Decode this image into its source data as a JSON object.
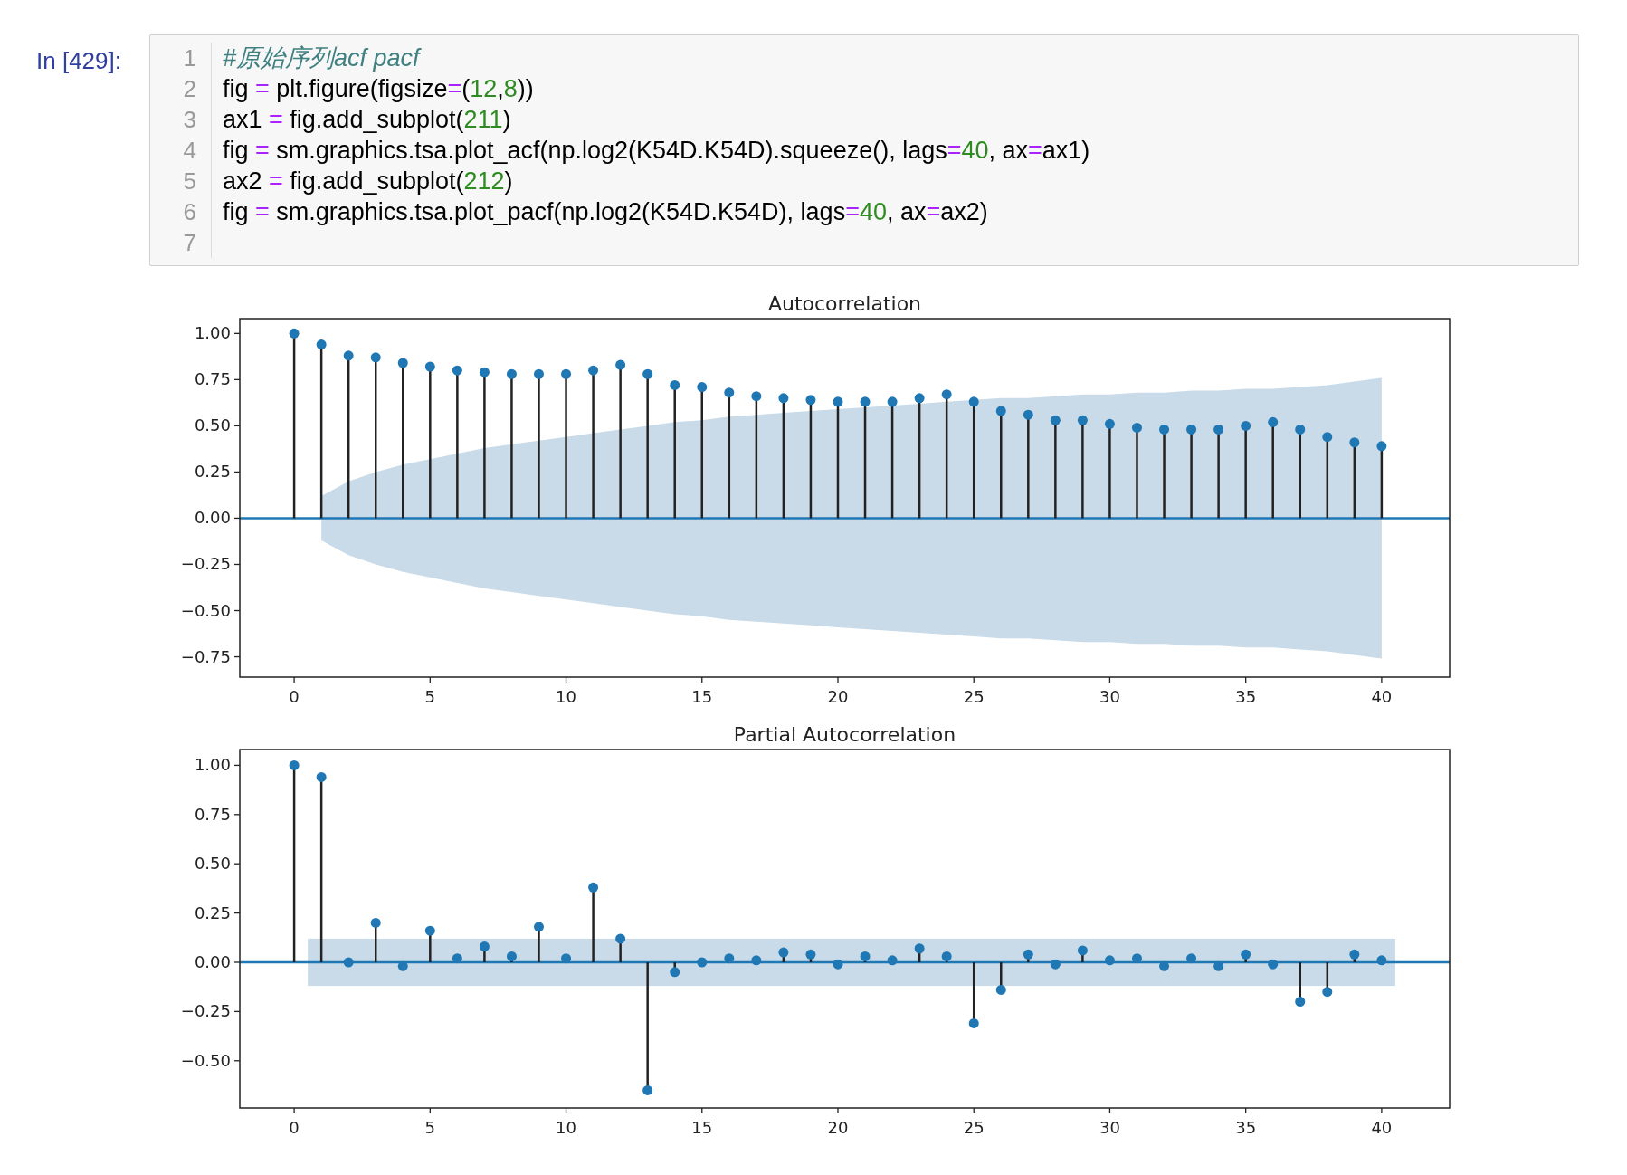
{
  "cell": {
    "prompt": "In [429]:",
    "lines": [
      {
        "number": "1",
        "tokens": [
          {
            "kind": "comment",
            "text": "#原始序列acf pacf"
          }
        ]
      },
      {
        "number": "2",
        "tokens": [
          {
            "kind": "text",
            "text": "fig "
          },
          {
            "kind": "op",
            "text": "="
          },
          {
            "kind": "text",
            "text": " plt.figure(figsize"
          },
          {
            "kind": "op",
            "text": "="
          },
          {
            "kind": "text",
            "text": "("
          },
          {
            "kind": "num",
            "text": "12"
          },
          {
            "kind": "text",
            "text": ","
          },
          {
            "kind": "num",
            "text": "8"
          },
          {
            "kind": "text",
            "text": "))"
          }
        ]
      },
      {
        "number": "3",
        "tokens": [
          {
            "kind": "text",
            "text": "ax1 "
          },
          {
            "kind": "op",
            "text": "="
          },
          {
            "kind": "text",
            "text": " fig.add_subplot("
          },
          {
            "kind": "num",
            "text": "211"
          },
          {
            "kind": "text",
            "text": ")"
          }
        ]
      },
      {
        "number": "4",
        "tokens": [
          {
            "kind": "text",
            "text": "fig "
          },
          {
            "kind": "op",
            "text": "="
          },
          {
            "kind": "text",
            "text": " sm.graphics.tsa.plot_acf(np.log2(K54D.K54D).squeeze(), lags"
          },
          {
            "kind": "op",
            "text": "="
          },
          {
            "kind": "num",
            "text": "40"
          },
          {
            "kind": "text",
            "text": ", ax"
          },
          {
            "kind": "op",
            "text": "="
          },
          {
            "kind": "text",
            "text": "ax1)"
          }
        ]
      },
      {
        "number": "5",
        "tokens": [
          {
            "kind": "text",
            "text": "ax2 "
          },
          {
            "kind": "op",
            "text": "="
          },
          {
            "kind": "text",
            "text": " fig.add_subplot("
          },
          {
            "kind": "num",
            "text": "212"
          },
          {
            "kind": "text",
            "text": ")"
          }
        ]
      },
      {
        "number": "6",
        "tokens": [
          {
            "kind": "text",
            "text": "fig "
          },
          {
            "kind": "op",
            "text": "="
          },
          {
            "kind": "text",
            "text": " sm.graphics.tsa.plot_pacf(np.log2(K54D.K54D), lags"
          },
          {
            "kind": "op",
            "text": "="
          },
          {
            "kind": "num",
            "text": "40"
          },
          {
            "kind": "text",
            "text": ", ax"
          },
          {
            "kind": "op",
            "text": "="
          },
          {
            "kind": "text",
            "text": "ax2)"
          }
        ]
      },
      {
        "number": "7"
      }
    ]
  },
  "charts": [
    {
      "chart_data": {
        "type": "scatter",
        "title": "Autocorrelation",
        "xlim": [
          -2,
          42.5
        ],
        "ylim": [
          -0.86,
          1.08
        ],
        "x": [
          0,
          1,
          2,
          3,
          4,
          5,
          6,
          7,
          8,
          9,
          10,
          11,
          12,
          13,
          14,
          15,
          16,
          17,
          18,
          19,
          20,
          21,
          22,
          23,
          24,
          25,
          26,
          27,
          28,
          29,
          30,
          31,
          32,
          33,
          34,
          35,
          36,
          37,
          38,
          39,
          40
        ],
        "series": [
          {
            "color": "#1f77b4",
            "values": [
              1.0,
              0.94,
              0.88,
              0.87,
              0.84,
              0.82,
              0.8,
              0.79,
              0.78,
              0.78,
              0.78,
              0.8,
              0.83,
              0.78,
              0.72,
              0.71,
              0.68,
              0.66,
              0.65,
              0.64,
              0.63,
              0.63,
              0.63,
              0.65,
              0.67,
              0.63,
              0.58,
              0.56,
              0.53,
              0.53,
              0.51,
              0.49,
              0.48,
              0.48,
              0.48,
              0.5,
              0.52,
              0.48,
              0.44,
              0.41,
              0.39
            ]
          },
          {
            "type": "area",
            "color": "#c9dbe9",
            "values": [
              null,
              0.12,
              0.2,
              0.25,
              0.29,
              0.32,
              0.35,
              0.38,
              0.4,
              0.42,
              0.44,
              0.46,
              0.48,
              0.5,
              0.52,
              0.53,
              0.55,
              0.56,
              0.57,
              0.58,
              0.59,
              0.6,
              0.61,
              0.62,
              0.63,
              0.64,
              0.65,
              0.65,
              0.66,
              0.67,
              0.67,
              0.68,
              0.68,
              0.69,
              0.69,
              0.7,
              0.7,
              0.71,
              0.72,
              0.74,
              0.76
            ]
          },
          {
            "type": "area",
            "color": "#c9dbe9",
            "values": [
              null,
              -0.12,
              -0.2,
              -0.25,
              -0.29,
              -0.32,
              -0.35,
              -0.38,
              -0.4,
              -0.42,
              -0.44,
              -0.46,
              -0.48,
              -0.5,
              -0.52,
              -0.53,
              -0.55,
              -0.56,
              -0.57,
              -0.58,
              -0.59,
              -0.6,
              -0.61,
              -0.62,
              -0.63,
              -0.64,
              -0.65,
              -0.65,
              -0.66,
              -0.67,
              -0.67,
              -0.68,
              -0.68,
              -0.69,
              -0.69,
              -0.7,
              -0.7,
              -0.71,
              -0.72,
              -0.74,
              -0.76
            ]
          }
        ],
        "xticks": [
          0,
          5,
          10,
          15,
          20,
          25,
          30,
          35,
          40
        ],
        "ref_lines": [
          {
            "axis": "y",
            "value": 0,
            "color": "#1f77b4"
          }
        ],
        "yticks": [
          {
            "value": 1,
            "label": "1.00"
          },
          {
            "value": 0.75,
            "label": "0.75"
          },
          {
            "value": 0.5,
            "label": "0.50"
          },
          {
            "value": 0.25,
            "label": "0.25"
          },
          {
            "value": 0,
            "label": "0.00"
          },
          {
            "value": -0.25,
            "label": "−0.25"
          },
          {
            "value": -0.5,
            "label": "−0.50"
          },
          {
            "value": -0.75,
            "label": "−0.75"
          }
        ]
      }
    },
    {
      "chart_data": {
        "type": "scatter",
        "title": "Partial Autocorrelation",
        "xlim": [
          -2,
          42.5
        ],
        "ylim": [
          -0.74,
          1.08
        ],
        "x": [
          0,
          1,
          2,
          3,
          4,
          5,
          6,
          7,
          8,
          9,
          10,
          11,
          12,
          13,
          14,
          15,
          16,
          17,
          18,
          19,
          20,
          21,
          22,
          23,
          24,
          25,
          26,
          27,
          28,
          29,
          30,
          31,
          32,
          33,
          34,
          35,
          36,
          37,
          38,
          39,
          40
        ],
        "series": [
          {
            "color": "#1f77b4",
            "values": [
              1.0,
              0.94,
              0.0,
              0.2,
              -0.02,
              0.16,
              0.02,
              0.08,
              0.03,
              0.18,
              0.02,
              0.38,
              0.12,
              -0.65,
              -0.05,
              0.0,
              0.02,
              0.01,
              0.05,
              0.04,
              -0.01,
              0.03,
              0.01,
              0.07,
              0.03,
              -0.31,
              -0.14,
              0.04,
              -0.01,
              0.06,
              0.01,
              0.02,
              -0.02,
              0.02,
              -0.02,
              0.04,
              -0.01,
              -0.2,
              -0.15,
              0.04,
              0.01
            ]
          }
        ],
        "xticks": [
          0,
          5,
          10,
          15,
          20,
          25,
          30,
          35,
          40
        ],
        "ref_lines": [
          {
            "axis": "y",
            "value": 0,
            "color": "#1f77b4"
          }
        ],
        "bands": [
          {
            "axis": "y",
            "from": -0.12,
            "to": 0.12,
            "color": "#c9dbe9"
          }
        ],
        "yticks": [
          {
            "value": 1,
            "label": "1.00"
          },
          {
            "value": 0.75,
            "label": "0.75"
          },
          {
            "value": 0.5,
            "label": "0.50"
          },
          {
            "value": 0.25,
            "label": "0.25"
          },
          {
            "value": 0,
            "label": "0.00"
          },
          {
            "value": -0.25,
            "label": "−0.25"
          },
          {
            "value": -0.5,
            "label": "−0.50"
          }
        ]
      }
    }
  ]
}
